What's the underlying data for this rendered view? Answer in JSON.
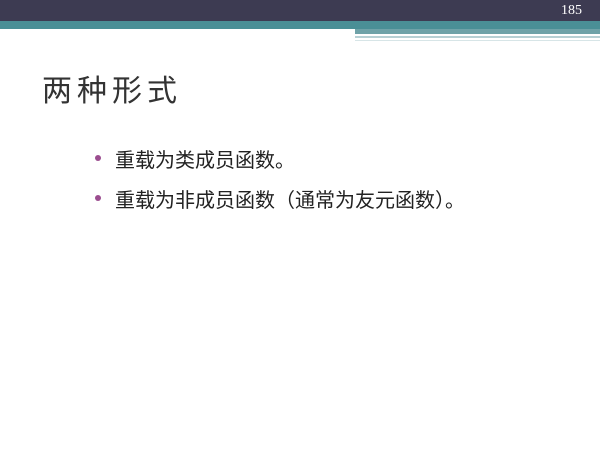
{
  "slide": {
    "page_number": "185",
    "title": "两种形式",
    "bullets": [
      "重载为类成员函数。",
      "重载为非成员函数（通常为友元函数）。"
    ]
  },
  "colors": {
    "header_band": "#3d3b52",
    "teal_band": "#4a8f96",
    "bullet": "#9b4d8f",
    "title_text": "#333333",
    "body_text": "#222222"
  }
}
